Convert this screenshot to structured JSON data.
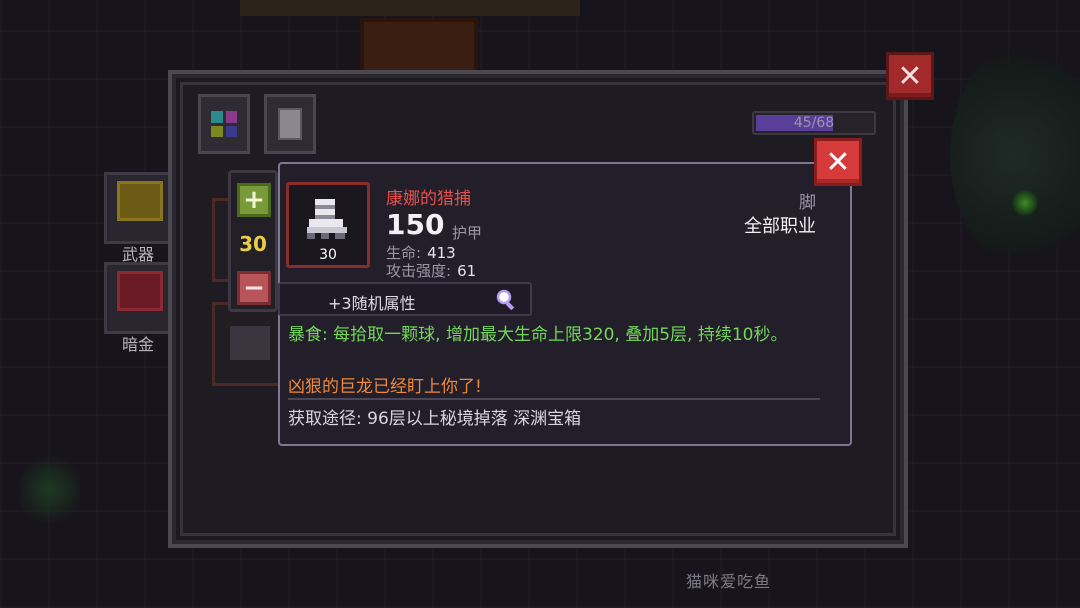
{
  "background": {
    "watermark": "猫咪爱吃鱼"
  },
  "side_tabs": {
    "weapon": {
      "label": "武器",
      "icon": "weapon-icon"
    },
    "gold": {
      "label": "暗金",
      "icon": "dark-gold-icon"
    }
  },
  "panel": {
    "close_icon": "close-icon",
    "tabs": [
      {
        "icon": "grid-icon"
      },
      {
        "icon": "scroll-icon"
      }
    ],
    "capacity": {
      "text": "45/68",
      "fraction": 0.66
    }
  },
  "stepper": {
    "plus": "+",
    "minus": "−",
    "value": "30"
  },
  "tooltip": {
    "close_label": "✕",
    "item": {
      "icon": "boot-icon",
      "count": "30",
      "name": "康娜的猎捕",
      "primary_value": "150",
      "primary_unit": "护甲",
      "stats": [
        {
          "label": "生命:",
          "value": "413"
        },
        {
          "label": "攻击强度:",
          "value": "61"
        }
      ],
      "slot": "脚",
      "class_requirement": "全部职业"
    },
    "random_attributes": "+3随机属性",
    "effect": "暴食: 每拾取一颗球, 增加最大生命上限320, 叠加5层, 持续10秒。",
    "flavor": "凶狠的巨龙已经盯上你了!",
    "source": "获取途径: 96层以上秘境掉落 深渊宝箱"
  },
  "colors": {
    "item_name": "#e8514a",
    "effect": "#74d65a",
    "flavor": "#f0893a",
    "stepper_value": "#e8cc4a"
  }
}
